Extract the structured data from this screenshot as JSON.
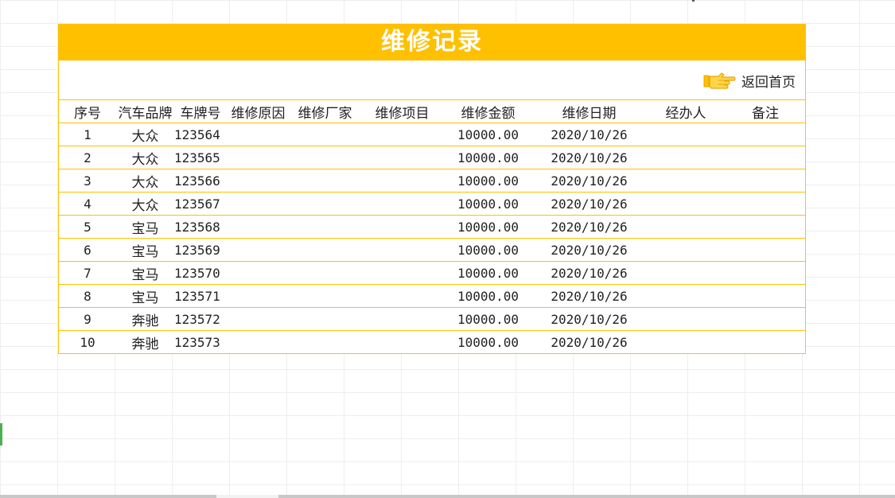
{
  "title": "维修记录",
  "home_link": {
    "label": "返回首页",
    "icon": "pointing-hand-icon"
  },
  "colors": {
    "accent": "#ffc000",
    "title_text": "#ffffff",
    "text": "#222222"
  },
  "columns": [
    "序号",
    "汽车品牌",
    "车牌号",
    "维修原因",
    "维修厂家",
    "维修项目",
    "维修金额",
    "维修日期",
    "经办人",
    "备注"
  ],
  "rows": [
    [
      "1",
      "大众",
      "123564",
      "",
      "",
      "",
      "10000.00",
      "2020/10/26",
      "",
      ""
    ],
    [
      "2",
      "大众",
      "123565",
      "",
      "",
      "",
      "10000.00",
      "2020/10/26",
      "",
      ""
    ],
    [
      "3",
      "大众",
      "123566",
      "",
      "",
      "",
      "10000.00",
      "2020/10/26",
      "",
      ""
    ],
    [
      "4",
      "大众",
      "123567",
      "",
      "",
      "",
      "10000.00",
      "2020/10/26",
      "",
      ""
    ],
    [
      "5",
      "宝马",
      "123568",
      "",
      "",
      "",
      "10000.00",
      "2020/10/26",
      "",
      ""
    ],
    [
      "6",
      "宝马",
      "123569",
      "",
      "",
      "",
      "10000.00",
      "2020/10/26",
      "",
      ""
    ],
    [
      "7",
      "宝马",
      "123570",
      "",
      "",
      "",
      "10000.00",
      "2020/10/26",
      "",
      ""
    ],
    [
      "8",
      "宝马",
      "123571",
      "",
      "",
      "",
      "10000.00",
      "2020/10/26",
      "",
      ""
    ],
    [
      "9",
      "奔驰",
      "123572",
      "",
      "",
      "",
      "10000.00",
      "2020/10/26",
      "",
      ""
    ],
    [
      "10",
      "奔驰",
      "123573",
      "",
      "",
      "",
      "10000.00",
      "2020/10/26",
      "",
      ""
    ]
  ]
}
